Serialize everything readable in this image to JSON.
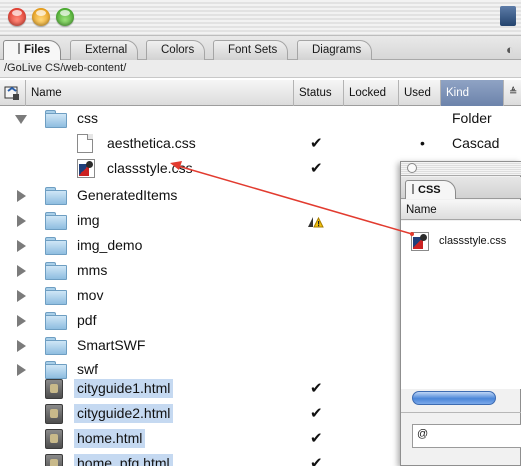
{
  "tabs": [
    "Files",
    "External",
    "Colors",
    "Font Sets",
    "Diagrams"
  ],
  "path": "/GoLive CS/web-content/",
  "columns": {
    "name": "Name",
    "status": "Status",
    "locked": "Locked",
    "used": "Used",
    "kind": "Kind"
  },
  "rows": [
    {
      "name": "css",
      "kind": "Folder"
    },
    {
      "name": "aesthetica.css",
      "status": "✔",
      "used": "•",
      "kind": "Cascad"
    },
    {
      "name": "classstyle.css",
      "status": "✔"
    },
    {
      "name": "GeneratedItems"
    },
    {
      "name": "img"
    },
    {
      "name": "img_demo"
    },
    {
      "name": "mms"
    },
    {
      "name": "mov"
    },
    {
      "name": "pdf"
    },
    {
      "name": "SmartSWF"
    },
    {
      "name": "swf"
    },
    {
      "name": "cityguide1.html",
      "status": "✔"
    },
    {
      "name": "cityguide2.html",
      "status": "✔"
    },
    {
      "name": "home.html",
      "status": "✔"
    },
    {
      "name": "home_pfg.html",
      "status": "✔"
    }
  ],
  "palette": {
    "tab": "CSS",
    "header": "Name",
    "item": "classstyle.css",
    "field_glyph": "@"
  },
  "colors": {
    "selection": "#c5d9f1",
    "kind_header": "#7a8fb4",
    "link_line": "#e23b2f"
  }
}
